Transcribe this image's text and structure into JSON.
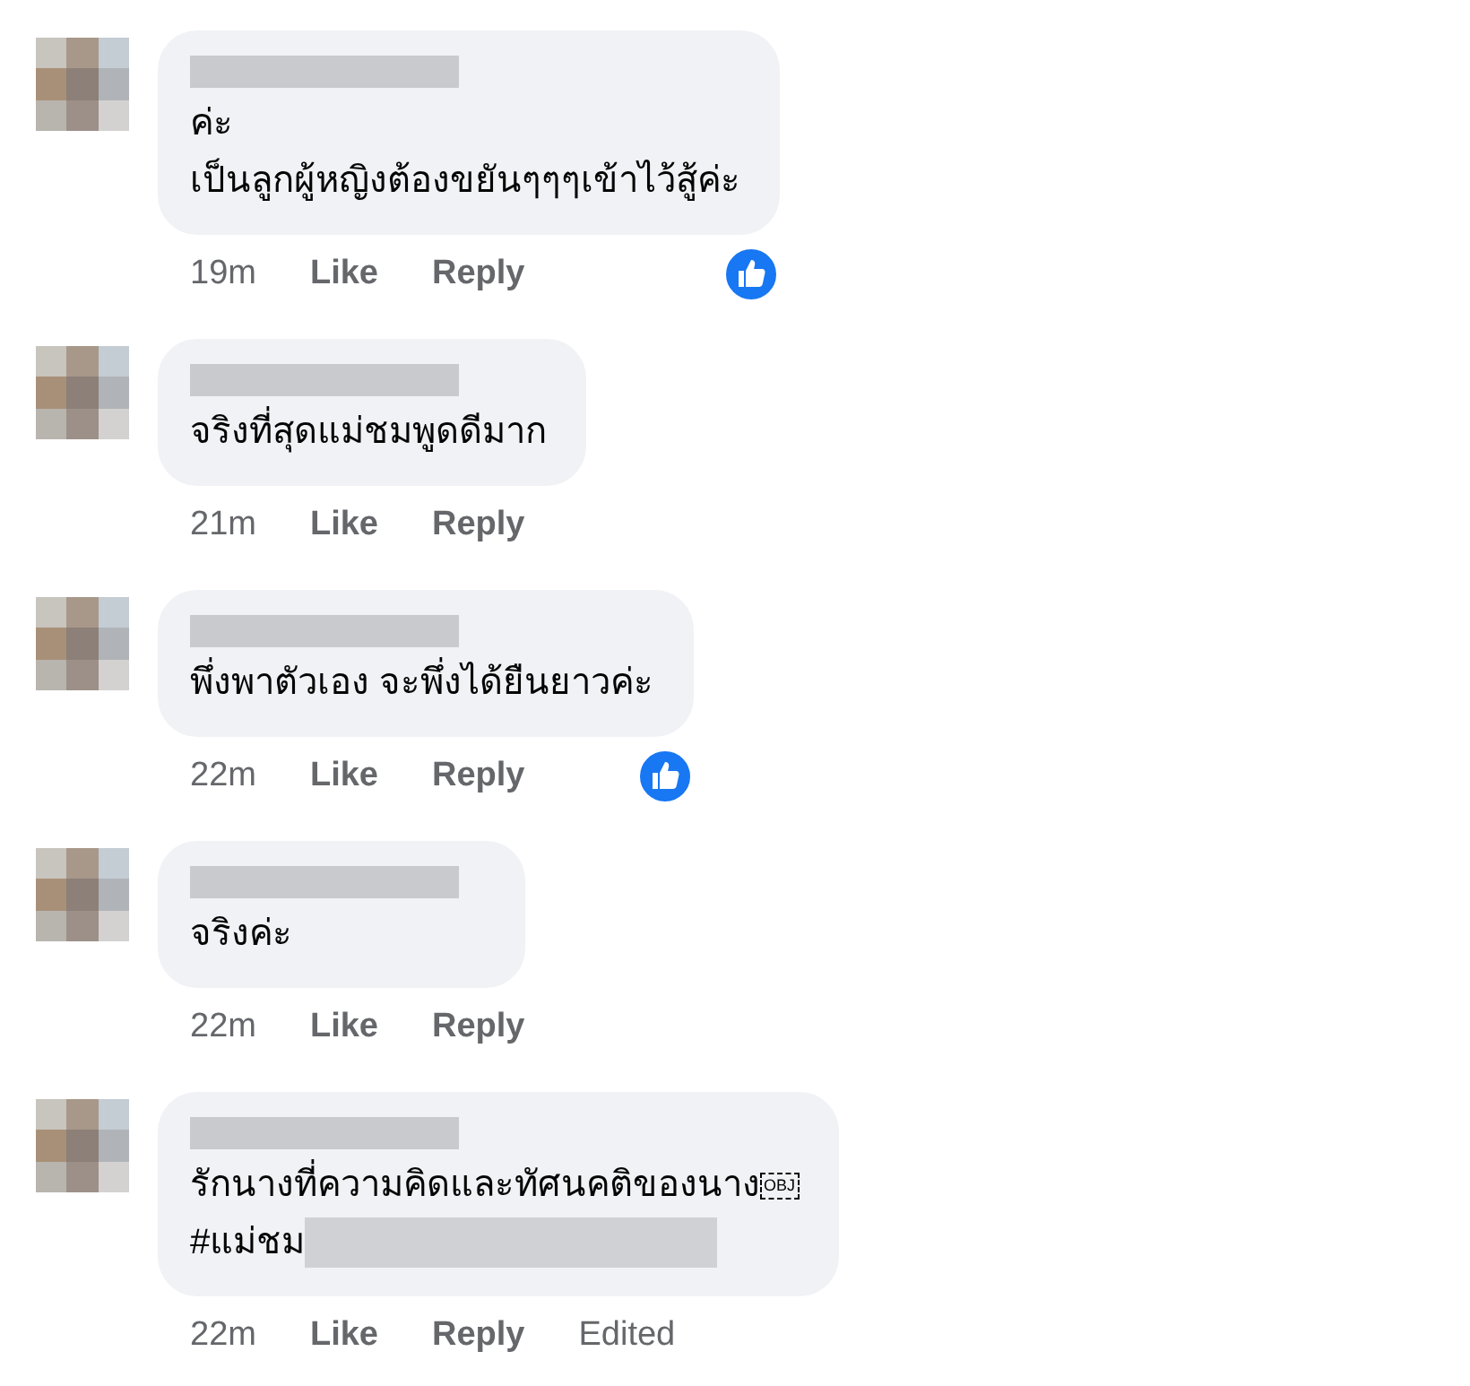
{
  "comments": [
    {
      "lines": [
        {
          "text": "ค่ะ"
        },
        {
          "text": "เป็นลูกผู้หญิงต้องขยันๆๆๆเข้าไว้สู้ค่ะ"
        }
      ],
      "time": "19m",
      "like": "Like",
      "reply": "Reply",
      "liked": true
    },
    {
      "lines": [
        {
          "text": "จริงที่สุดแม่ชมพูดดีมาก"
        }
      ],
      "time": "21m",
      "like": "Like",
      "reply": "Reply",
      "liked": false
    },
    {
      "lines": [
        {
          "text": "พึ่งพาตัวเอง จะพึ่งได้ยืนยาวค่ะ"
        }
      ],
      "time": "22m",
      "like": "Like",
      "reply": "Reply",
      "liked": true
    },
    {
      "lines": [
        {
          "text": "จริงค่ะ"
        }
      ],
      "time": "22m",
      "like": "Like",
      "reply": "Reply",
      "liked": false
    },
    {
      "lines": [
        {
          "text": "รักนางที่ความคิดและทัศนคติของนาง",
          "glyph": "OBJ"
        },
        {
          "text": "#แม่ชม",
          "redacted_tail": true
        }
      ],
      "time": "22m",
      "like": "Like",
      "reply": "Reply",
      "edited": "Edited",
      "liked": false
    }
  ]
}
